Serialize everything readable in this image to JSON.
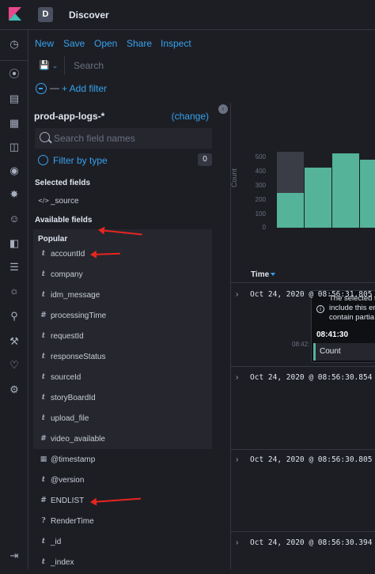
{
  "app": {
    "space_initial": "D",
    "title": "Discover"
  },
  "menu": {
    "new": "New",
    "save": "Save",
    "open": "Open",
    "share": "Share",
    "inspect": "Inspect"
  },
  "query": {
    "placeholder": "Search"
  },
  "filters": {
    "add_label": "+ Add filter",
    "dash": "—"
  },
  "sidebar": {
    "index_pattern": "prod-app-logs-*",
    "change_label": "(change)",
    "field_search_placeholder": "Search field names",
    "filter_by_type_label": "Filter by type",
    "filter_count": "0",
    "selected_fields_title": "Selected fields",
    "selected_fields": [
      {
        "type": "</>",
        "name": "_source"
      }
    ],
    "available_fields_title": "Available fields",
    "popular_title": "Popular",
    "popular_fields": [
      {
        "type": "t",
        "name": "accountId"
      },
      {
        "type": "t",
        "name": "company"
      },
      {
        "type": "t",
        "name": "idm_message"
      },
      {
        "type": "#",
        "name": "processingTime"
      },
      {
        "type": "t",
        "name": "requestId"
      },
      {
        "type": "t",
        "name": "responseStatus"
      },
      {
        "type": "t",
        "name": "sourceId"
      },
      {
        "type": "t",
        "name": "storyBoardId"
      },
      {
        "type": "t",
        "name": "upload_file"
      },
      {
        "type": "#",
        "name": "video_available"
      }
    ],
    "other_fields": [
      {
        "type": "▦",
        "name": "@timestamp"
      },
      {
        "type": "t",
        "name": "@version"
      },
      {
        "type": "#",
        "name": "ENDLIST"
      },
      {
        "type": "?",
        "name": "RenderTime"
      },
      {
        "type": "t",
        "name": "_id"
      },
      {
        "type": "t",
        "name": "_index"
      }
    ]
  },
  "chart_data": {
    "type": "bar",
    "ylabel": "Count",
    "yticks": [
      "500",
      "400",
      "300",
      "200",
      "100",
      "0"
    ],
    "ylim": [
      0,
      500
    ],
    "x_tick": "08:42:",
    "values": [
      240,
      420,
      520,
      480
    ],
    "highlight_index": 0,
    "colors": {
      "bar": "#54b399",
      "highlight": "#3a3d45"
    }
  },
  "tooltip": {
    "line1": "The selected t",
    "line2": "include this en",
    "line3": "contain partia",
    "info_icon": "i",
    "time": "08:41:30",
    "series_label": "Count"
  },
  "table": {
    "time_header": "Time",
    "rows": [
      "Oct 24, 2020 @ 08:56:31.805",
      "Oct 24, 2020 @ 08:56:30.854",
      "Oct 24, 2020 @ 08:56:30.805",
      "Oct 24, 2020 @ 08:56:30.394"
    ]
  },
  "colors": {
    "accent": "#36a2ef",
    "annotation_arrow": "#e7251f",
    "background": "#1d1e24"
  }
}
